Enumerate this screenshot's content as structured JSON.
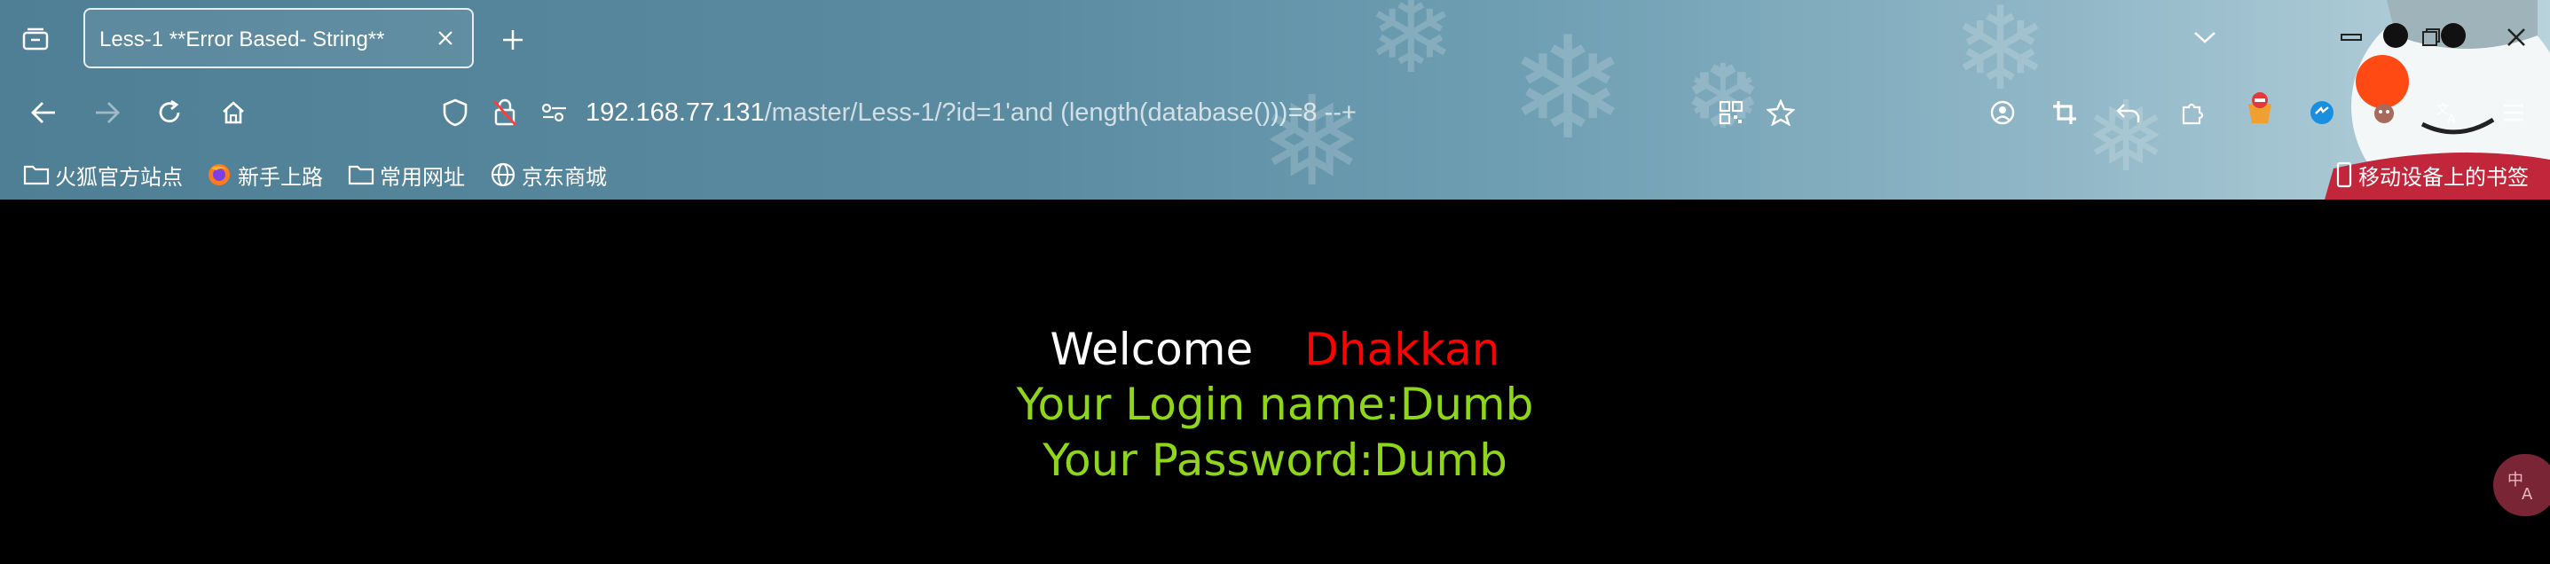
{
  "tab": {
    "title": "Less-1 **Error Based- String**"
  },
  "address": {
    "host": "192.168.77.131",
    "path": "/master/Less-1/?id=1'and (length(database()))=8 --+"
  },
  "bookmarks": {
    "items": [
      {
        "label": "火狐官方站点",
        "icon": "folder-icon"
      },
      {
        "label": "新手上路",
        "icon": "firefox-icon"
      },
      {
        "label": "常用网址",
        "icon": "folder-icon"
      },
      {
        "label": "京东商城",
        "icon": "globe-icon"
      }
    ],
    "mobile": "移动设备上的书签"
  },
  "page": {
    "welcome": "Welcome",
    "name": "Dhakkan",
    "login_line": "Your Login name:Dumb",
    "password_line": "Your Password:Dumb"
  },
  "colors": {
    "accent_red": "#ff0000",
    "text_green": "#8fd61a",
    "bg": "#000000"
  }
}
